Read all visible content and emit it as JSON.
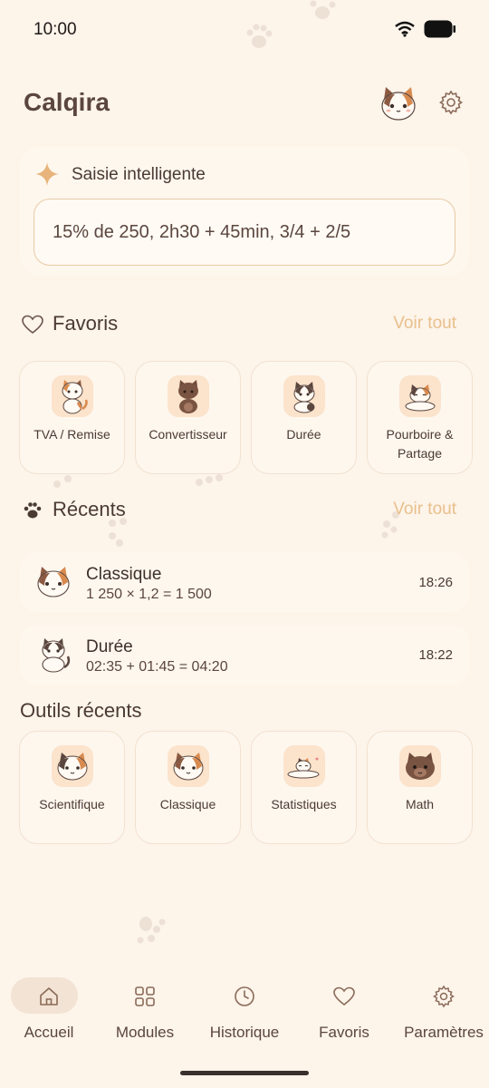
{
  "status_bar": {
    "time": "10:00"
  },
  "app": {
    "title": "Calqira"
  },
  "smart_input": {
    "title": "Saisie intelligente",
    "value": "15% de 250, 2h30 + 45min, 3/4 + 2/5"
  },
  "favorites": {
    "title": "Favoris",
    "see_all": "Voir tout",
    "items": [
      {
        "label": "TVA / Remise",
        "icon": "cat-calico-icon"
      },
      {
        "label": "Convertisseur",
        "icon": "cat-brown-icon"
      },
      {
        "label": "Durée",
        "icon": "cat-tabby-icon"
      },
      {
        "label": "Pourboire & Partage",
        "icon": "cat-lying-icon"
      }
    ]
  },
  "recents": {
    "title": "Récents",
    "see_all": "Voir tout",
    "items": [
      {
        "title": "Classique",
        "expression": "1 250 × 1,2 = 1 500",
        "time": "18:26"
      },
      {
        "title": "Durée",
        "expression": "02:35 + 01:45 = 04:20",
        "time": "18:22"
      }
    ]
  },
  "recent_tools": {
    "title": "Outils récents",
    "items": [
      {
        "label": "Scientifique",
        "icon": "cat-face-icon"
      },
      {
        "label": "Classique",
        "icon": "cat-face-icon"
      },
      {
        "label": "Statistiques",
        "icon": "cat-sleeping-icon"
      },
      {
        "label": "Math",
        "icon": "cat-brown-face-icon"
      }
    ]
  },
  "bottom_nav": [
    {
      "label": "Accueil",
      "icon": "home-icon",
      "active": true
    },
    {
      "label": "Modules",
      "icon": "grid-icon"
    },
    {
      "label": "Historique",
      "icon": "clock-icon"
    },
    {
      "label": "Favoris",
      "icon": "heart-icon"
    },
    {
      "label": "Paramètres",
      "icon": "gear-icon"
    }
  ],
  "colors": {
    "background": "#fdf4ea",
    "accent": "#e8c08c",
    "text": "#4a3a34",
    "calico_orange": "#d98a4e"
  }
}
